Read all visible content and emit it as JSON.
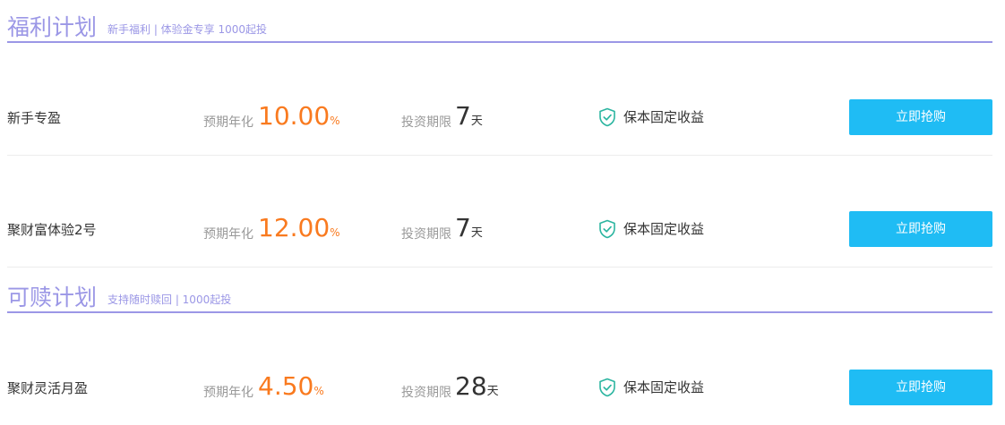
{
  "sections": [
    {
      "title": "福利计划",
      "subtitle": "新手福利 | 体验金专享 1000起投",
      "products": [
        {
          "name": "新手专盈",
          "rate_label": "预期年化",
          "rate": "10.00",
          "rate_unit": "%",
          "term_label": "投资期限",
          "term": "7",
          "term_unit": "天",
          "guarantee": "保本固定收益",
          "button": "立即抢购"
        },
        {
          "name": "聚财富体验2号",
          "rate_label": "预期年化",
          "rate": "12.00",
          "rate_unit": "%",
          "term_label": "投资期限",
          "term": "7",
          "term_unit": "天",
          "guarantee": "保本固定收益",
          "button": "立即抢购"
        }
      ]
    },
    {
      "title": "可赎计划",
      "subtitle": "支持随时赎回 | 1000起投",
      "products": [
        {
          "name": "聚财灵活月盈",
          "rate_label": "预期年化",
          "rate": "4.50",
          "rate_unit": "%",
          "term_label": "投资期限",
          "term": "28",
          "term_unit": "天",
          "guarantee": "保本固定收益",
          "button": "立即抢购"
        }
      ]
    }
  ],
  "colors": {
    "accent": "#9b97e6",
    "rate": "#f97a1f",
    "button": "#1fbcf4",
    "shield": "#2bb5a0"
  },
  "icons": {
    "guarantee": "shield-check-icon"
  }
}
